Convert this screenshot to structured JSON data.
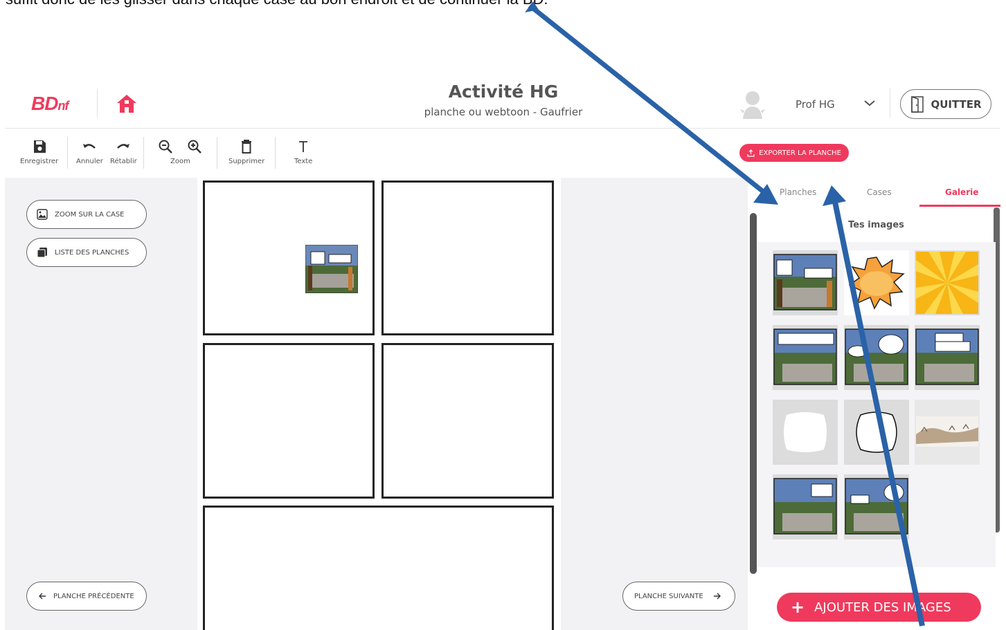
{
  "doc_caption": "suffit donc de les glisser dans chaque case au bon endroit et de continuer la BD.",
  "header": {
    "logo_text": "BDnf",
    "title": "Activité HG",
    "subtitle": "planche ou webtoon - Gaufrier",
    "user_name": "Prof HG",
    "quit_label": "QUITTER"
  },
  "toolbar": {
    "save_label": "Enregistrer",
    "undo_label": "Annuler",
    "redo_label": "Rétablir",
    "zoom_label": "Zoom",
    "delete_label": "Supprimer",
    "text_label": "Texte",
    "export_label": "EXPORTER LA PLANCHE"
  },
  "left_panel": {
    "zoom_case_label": "ZOOM SUR LA CASE",
    "list_boards_label": "LISTE DES PLANCHES",
    "prev_board_label": "PLANCHE PRÉCÉDENTE"
  },
  "next_board_label": "PLANCHE SUIVANTE",
  "tabs": [
    {
      "label": "Planches",
      "active": false
    },
    {
      "label": "Cases",
      "active": false
    },
    {
      "label": "Galerie",
      "active": true
    }
  ],
  "gallery": {
    "title": "Tes images",
    "add_label": "AJOUTER DES IMAGES",
    "images": [
      "comic-acropolis-1",
      "explosion-cloud",
      "yellow-sunburst",
      "comic-acropolis-2",
      "comic-acropolis-3",
      "comic-acropolis-4",
      "speech-bubble-filled",
      "speech-bubble-outline",
      "ruins-photo",
      "comic-acropolis-5",
      "comic-acropolis-6"
    ]
  },
  "colors": {
    "accent": "#ef3a5d",
    "arrow": "#2a62a8",
    "panel_bg": "#f2f2f4"
  }
}
